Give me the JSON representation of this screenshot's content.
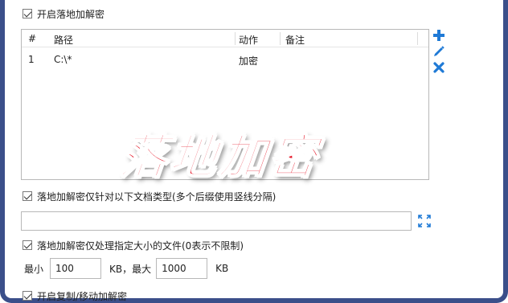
{
  "options": {
    "enable_local_decrypt": "开启落地加解密",
    "doc_types_only": "落地加解密仅针对以下文档类型(多个后缀使用竖线分隔)",
    "size_limit": "落地加解密仅处理指定大小的文件(0表示不限制)",
    "copy_move_decrypt": "开启复制/移动加解密"
  },
  "table": {
    "headers": {
      "index": "#",
      "path": "路径",
      "action": "动作",
      "remark": "备注"
    },
    "rows": [
      {
        "index": "1",
        "path": "C:\\*",
        "action": "加密",
        "remark": ""
      }
    ]
  },
  "icons": {
    "add": "plus-icon",
    "edit": "pencil-icon",
    "delete": "x-icon",
    "expand": "expand-icon"
  },
  "watermark": "落地加密",
  "doc_types_input": {
    "value": ""
  },
  "size": {
    "min_label": "最小",
    "min_value": "100",
    "mid_label": "KB，最大",
    "max_value": "1000",
    "unit": "KB"
  },
  "colors": {
    "accent": "#1f7ad6",
    "watermark": "#e61b2c",
    "frame": "#3b4f8a"
  }
}
